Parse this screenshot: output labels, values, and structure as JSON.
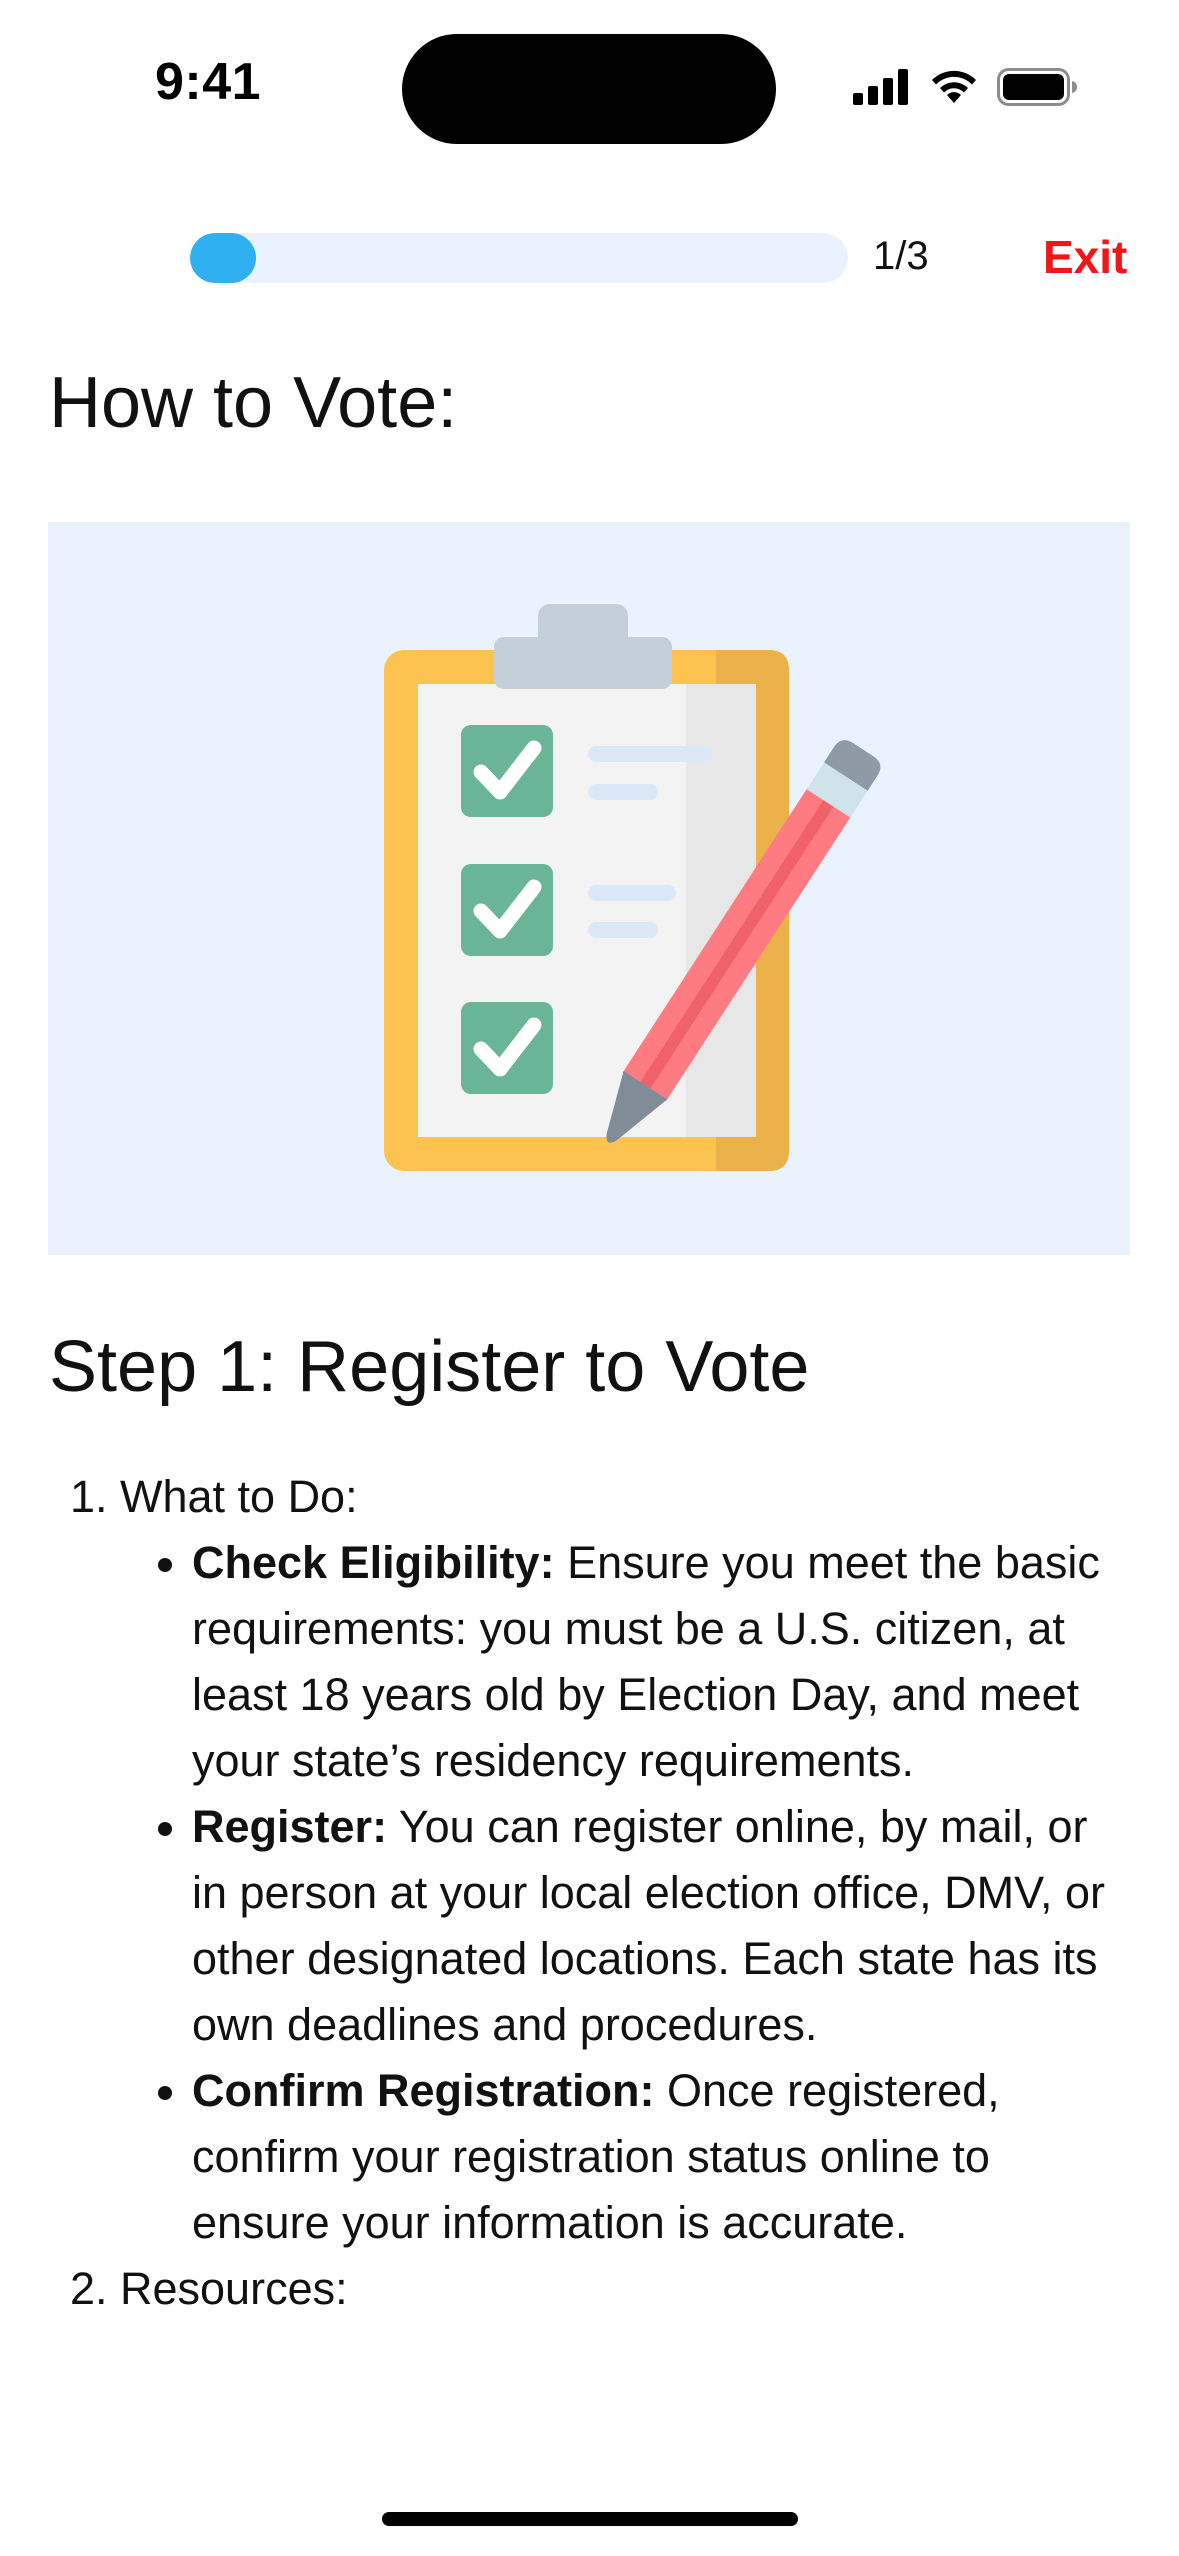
{
  "status_bar": {
    "time": "9:41"
  },
  "progress": {
    "fraction": 0.3333,
    "count_label": "1/3",
    "fill_color": "#2eb0f1",
    "track_color": "#eaf3fd"
  },
  "header": {
    "exit_label": "Exit",
    "exit_color": "#f21616"
  },
  "page": {
    "title": "How to Vote:",
    "hero_icon": "clipboard-checklist-with-pencil-icon"
  },
  "step": {
    "title": "Step 1: Register to Vote",
    "sections": [
      {
        "label": "What to Do:",
        "items": [
          {
            "bold": "Check Eligibility:",
            "text": " Ensure you meet the basic requirements: you must be a U.S. citizen, at least 18 years old by Election Day, and meet your state’s residency requirements."
          },
          {
            "bold": "Register:",
            "text": " You can register online, by mail, or in person at your local election office, DMV, or other designated locations. Each state has its own deadlines and procedures."
          },
          {
            "bold": "Confirm Registration:",
            "text": " Once registered, confirm your registration status online to ensure your information is accurate."
          }
        ]
      },
      {
        "label": "Resources:"
      }
    ]
  }
}
